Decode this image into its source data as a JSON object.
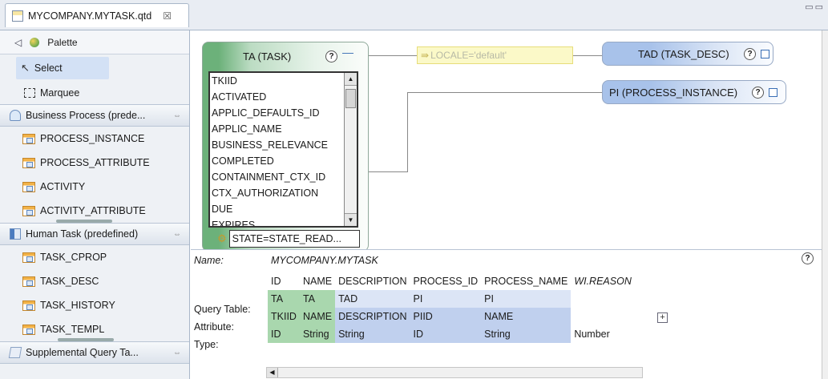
{
  "editor_tab": {
    "title": "MYCOMPANY.MYTASK.qtd",
    "close": "☒"
  },
  "palette": {
    "title": "Palette",
    "tools": [
      {
        "label": "Select"
      },
      {
        "label": "Marquee"
      }
    ],
    "drawers": [
      {
        "label": "Business Process (prede...",
        "items": [
          "PROCESS_INSTANCE",
          "PROCESS_ATTRIBUTE",
          "ACTIVITY",
          "ACTIVITY_ATTRIBUTE"
        ]
      },
      {
        "label": "Human Task (predefined)",
        "items": [
          "TASK_CPROP",
          "TASK_DESC",
          "TASK_HISTORY",
          "TASK_TEMPL"
        ]
      },
      {
        "label": "Supplemental Query Ta...",
        "items": []
      }
    ]
  },
  "canvas": {
    "task_node": {
      "title": "TA (TASK)",
      "columns": [
        "TKIID",
        "ACTIVATED",
        "APPLIC_DEFAULTS_ID",
        "APPLIC_NAME",
        "BUSINESS_RELEVANCE",
        "COMPLETED",
        "CONTAINMENT_CTX_ID",
        "CTX_AUTHORIZATION",
        "DUE",
        "EXPIRES"
      ],
      "filter": "STATE=STATE_READ..."
    },
    "locale_condition": "LOCALE='default'",
    "tad_node": {
      "title": "TAD (TASK_DESC)"
    },
    "pi_node": {
      "title": "PI (PROCESS_INSTANCE)"
    }
  },
  "properties": {
    "name_label": "Name:",
    "name_value": "MYCOMPANY.MYTASK",
    "row_labels": {
      "query_table": "Query Table:",
      "attribute": "Attribute:",
      "type": "Type:"
    },
    "columns": [
      {
        "name": "ID",
        "query_table": "TA",
        "attribute": "TKIID",
        "type": "ID"
      },
      {
        "name": "NAME",
        "query_table": "TA",
        "attribute": "NAME",
        "type": "String"
      },
      {
        "name": "DESCRIPTION",
        "query_table": "TAD",
        "attribute": "DESCRIPTION",
        "type": "String"
      },
      {
        "name": "PROCESS_ID",
        "query_table": "PI",
        "attribute": "PIID",
        "type": "ID"
      },
      {
        "name": "PROCESS_NAME",
        "query_table": "PI",
        "attribute": "NAME",
        "type": "String"
      },
      {
        "name": "WI.REASON",
        "query_table": "",
        "attribute": "",
        "type": "Number"
      }
    ],
    "add_label": "+"
  },
  "colors": {
    "green": "#a9d7ae",
    "blue": "#c0d0ee",
    "locale_bg": "#fbf9c8"
  }
}
